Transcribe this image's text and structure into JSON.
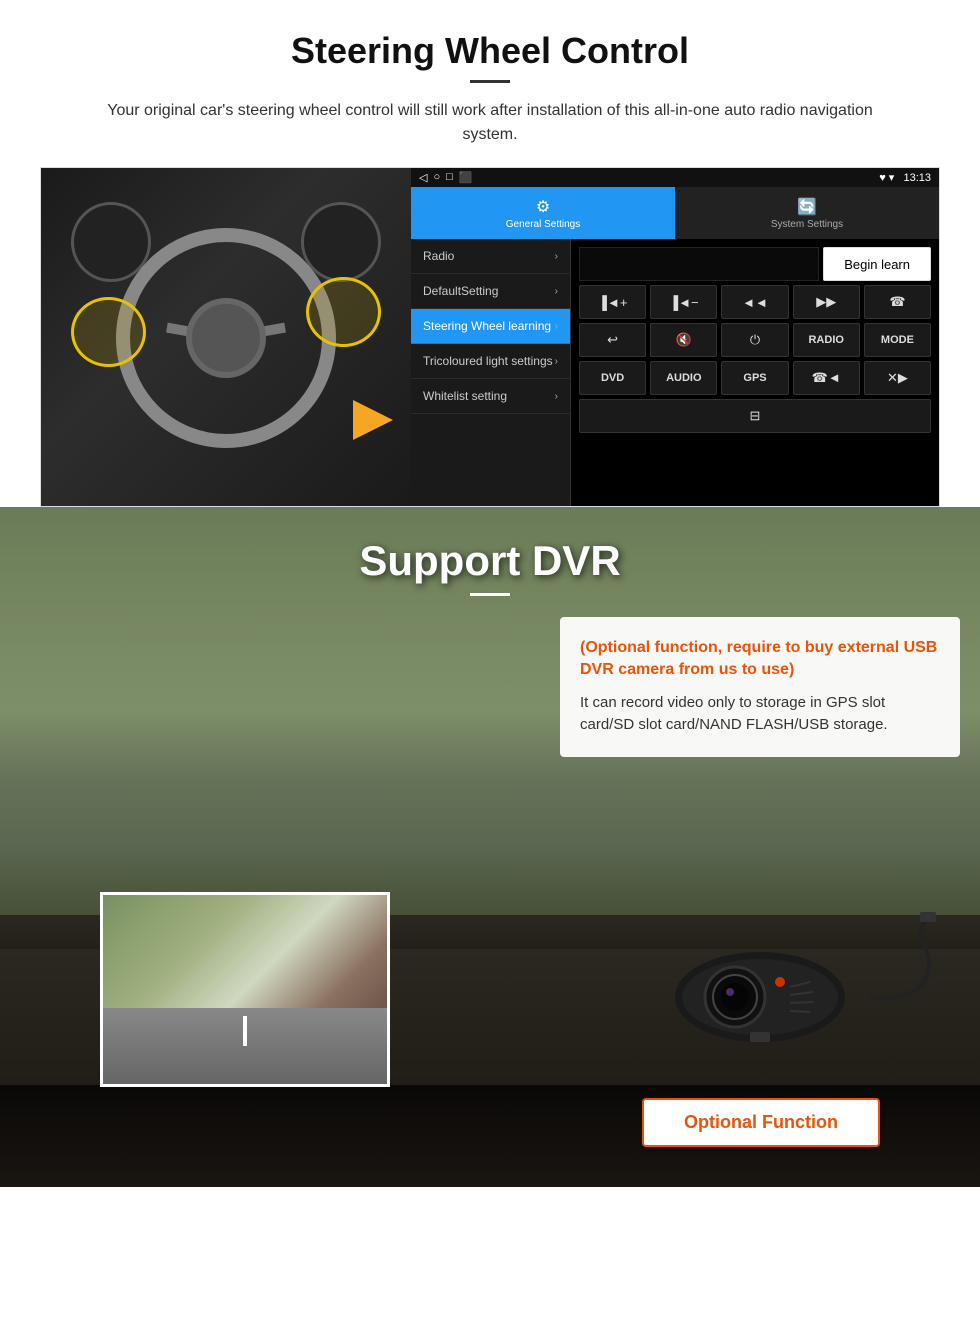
{
  "steering_section": {
    "title": "Steering Wheel Control",
    "subtitle": "Your original car's steering wheel control will still work after installation of this all-in-one auto radio navigation system.",
    "statusbar": {
      "back": "◁",
      "home": "○",
      "square": "□",
      "record": "⬛",
      "signal": "♥ ▾",
      "time": "13:13"
    },
    "tabs": {
      "general": "General Settings",
      "system": "System Settings"
    },
    "menu_items": [
      {
        "label": "Radio",
        "active": false
      },
      {
        "label": "DefaultSetting",
        "active": false
      },
      {
        "label": "Steering Wheel learning",
        "active": true
      },
      {
        "label": "Tricoloured light settings",
        "active": false
      },
      {
        "label": "Whitelist setting",
        "active": false
      }
    ],
    "begin_learn": "Begin learn",
    "control_buttons": [
      [
        "▐◄+",
        "▐◄−",
        "◄◄",
        "▶▶",
        "☎"
      ],
      [
        "↩",
        "▐◄✕",
        "⏻",
        "RADIO",
        "MODE"
      ],
      [
        "DVD",
        "AUDIO",
        "GPS",
        "☎◄◄",
        "✕▶▶"
      ],
      [
        "⊟"
      ]
    ]
  },
  "dvr_section": {
    "title": "Support DVR",
    "optional_text": "(Optional function, require to buy external USB DVR camera from us to use)",
    "description_text": "It can record video only to storage in GPS slot card/SD slot card/NAND FLASH/USB storage.",
    "optional_button": "Optional Function"
  }
}
